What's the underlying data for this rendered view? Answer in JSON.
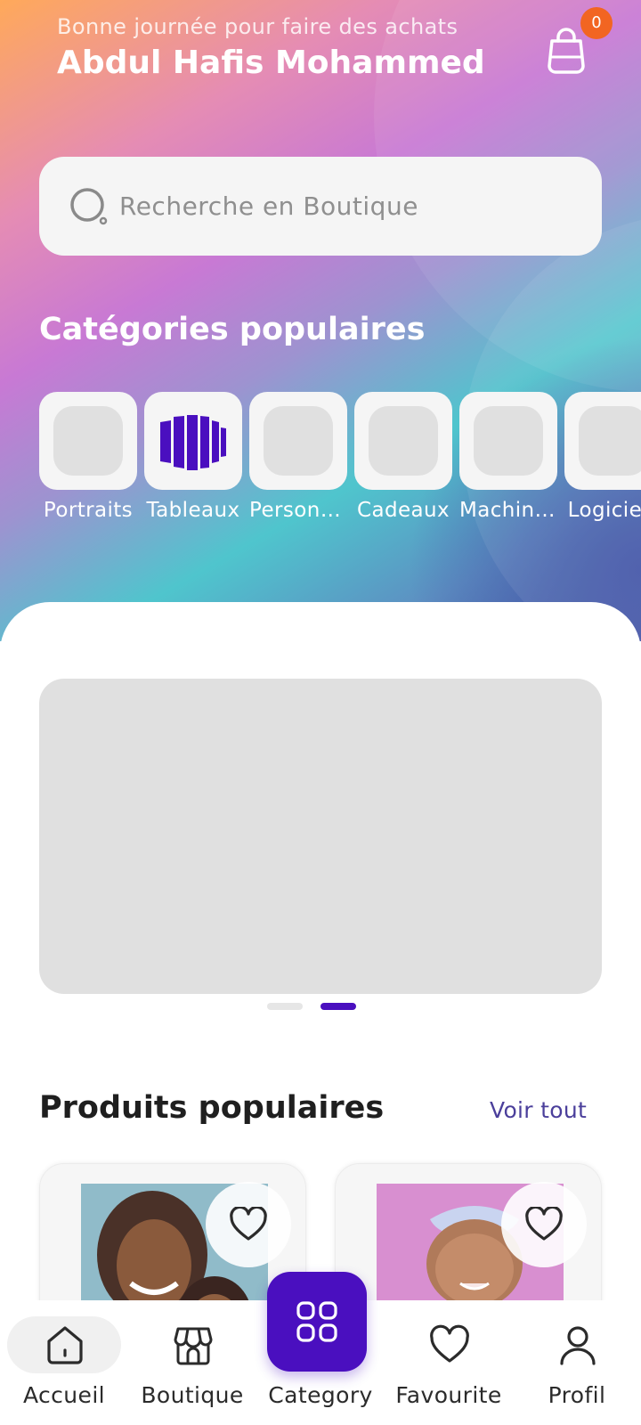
{
  "header": {
    "greeting": "Bonne journée pour faire des achats",
    "username": "Abdul Hafis Mohammed",
    "cart_count": "0",
    "cart_icon": "shopping-bag-icon"
  },
  "search": {
    "placeholder": "Recherche en Boutique",
    "icon": "search-icon"
  },
  "categories": {
    "title": "Catégories populaires",
    "items": [
      {
        "label": "Portraits"
      },
      {
        "label": "Tableaux"
      },
      {
        "label": "Personnalisés"
      },
      {
        "label": "Cadeaux"
      },
      {
        "label": "Machines"
      },
      {
        "label": "Logiciels"
      }
    ]
  },
  "carousel": {
    "pages": 2,
    "active_index": 1
  },
  "products": {
    "title": "Produits populaires",
    "see_all": "Voir tout"
  },
  "nav": {
    "items": [
      {
        "label": "Accueil",
        "icon": "home-icon",
        "active": true
      },
      {
        "label": "Boutique",
        "icon": "store-icon"
      },
      {
        "label": "Category",
        "icon": "grid-icon"
      },
      {
        "label": "Favourite",
        "icon": "heart-icon"
      },
      {
        "label": "Profil",
        "icon": "user-icon"
      }
    ]
  },
  "colors": {
    "accent": "#4a0fbf",
    "badge": "#f26522",
    "link": "#4b3f9b"
  }
}
